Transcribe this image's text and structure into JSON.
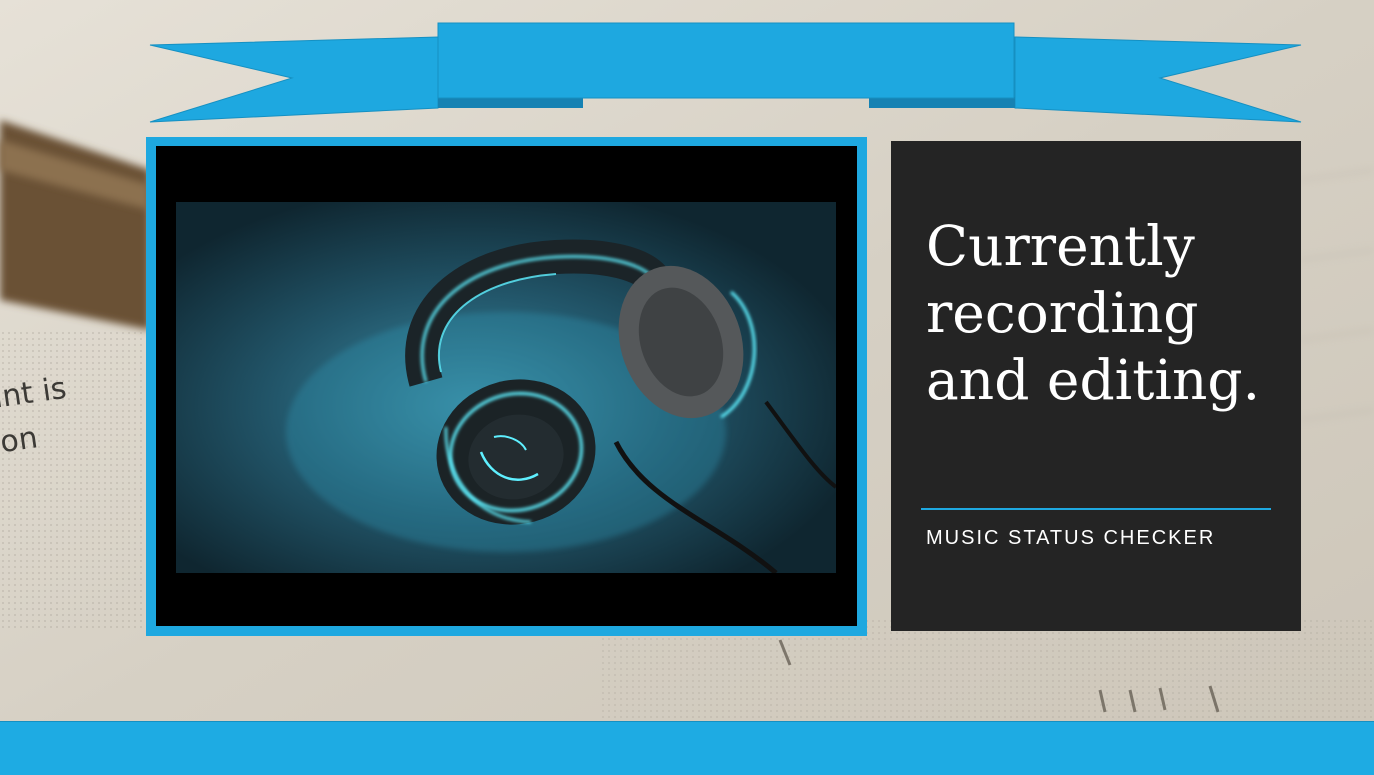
{
  "slide": {
    "title": "Currently recording and editing.",
    "subtitle": "MUSIC STATUS CHECKER"
  },
  "background": {
    "description_text_fragments": [
      "int is",
      "on"
    ]
  },
  "icons": {
    "photo": "headphones-image",
    "banner": "ribbon-banner"
  },
  "colors": {
    "accent": "#1ea8e0",
    "panel": "#242424",
    "frame_inner": "#000000"
  }
}
